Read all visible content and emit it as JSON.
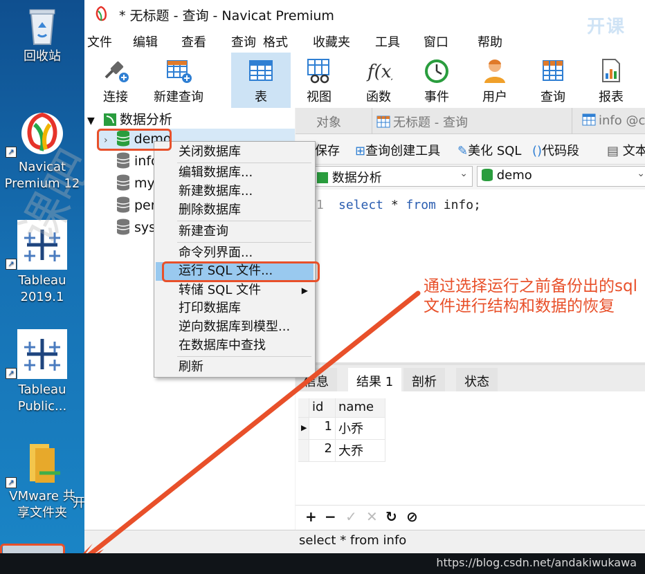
{
  "desktop": {
    "icons": [
      {
        "label": "回收站",
        "icon": "recycle-bin-icon"
      },
      {
        "label": "Navicat\nPremium 12",
        "icon": "navicat-icon"
      },
      {
        "label": "Tableau\n2019.1",
        "icon": "tableau-icon"
      },
      {
        "label": "Tableau\nPublic...",
        "icon": "tableau-icon"
      },
      {
        "label": "VMware 共\n享文件夹",
        "icon": "folder-icon"
      }
    ]
  },
  "window": {
    "title": "* 无标题 - 查询 - Navicat Premium"
  },
  "menu": {
    "items": [
      "文件",
      "编辑",
      "查看",
      "查询",
      "格式",
      "收藏夹",
      "工具",
      "窗口",
      "帮助"
    ]
  },
  "toolbar": {
    "items": [
      {
        "label": "连接",
        "icon": "connect-icon"
      },
      {
        "label": "新建查询",
        "icon": "new-query-icon"
      },
      {
        "label": "表",
        "icon": "table-icon",
        "active": true
      },
      {
        "label": "视图",
        "icon": "view-icon"
      },
      {
        "label": "函数",
        "icon": "function-icon"
      },
      {
        "label": "事件",
        "icon": "clock-icon"
      },
      {
        "label": "用户",
        "icon": "user-icon"
      },
      {
        "label": "查询",
        "icon": "query-icon"
      },
      {
        "label": "报表",
        "icon": "report-icon"
      }
    ]
  },
  "tree": {
    "connection": "数据分析",
    "databases": [
      "demo",
      "info",
      "my",
      "per",
      "sys"
    ]
  },
  "tabs": {
    "objects": "对象",
    "query_tab": "无标题 - 查询",
    "info_tab": "info @c"
  },
  "query_toolbar": {
    "save": "保存",
    "builder": "查询创建工具",
    "beautify": "美化 SQL",
    "snippet": "代码段",
    "text": "文本"
  },
  "selectors": {
    "connection": "数据分析",
    "database": "demo"
  },
  "editor": {
    "line_number": "1",
    "kw_select": "select",
    "star": " * ",
    "kw_from": "from",
    "rest": " info;"
  },
  "result_tabs": [
    "信息",
    "结果 1",
    "剖析",
    "状态"
  ],
  "results": {
    "columns": [
      "id",
      "name"
    ],
    "rows": [
      [
        "1",
        "小乔"
      ],
      [
        "2",
        "大乔"
      ]
    ]
  },
  "status_sql": "select * from info",
  "context_menu": {
    "items": [
      "关闭数据库",
      "编辑数据库...",
      "新建数据库...",
      "删除数据库",
      "新建查询",
      "命令列界面...",
      "运行 SQL 文件...",
      "转储 SQL 文件",
      "打印数据库",
      "逆向数据库到模型...",
      "在数据库中查找",
      "刷新"
    ],
    "highlighted": "运行 SQL 文件..."
  },
  "annotation": "通过选择运行之前备份出的sql文件进行结构和数据的恢复",
  "watermark_logo": "开课",
  "watermark_diag": "课吧",
  "taskbar_url": "https://blog.csdn.net/andakiwukawa",
  "colors": {
    "accent": "#e8502a",
    "highlight": "#99c9ef",
    "keyword": "#2a5db0"
  }
}
